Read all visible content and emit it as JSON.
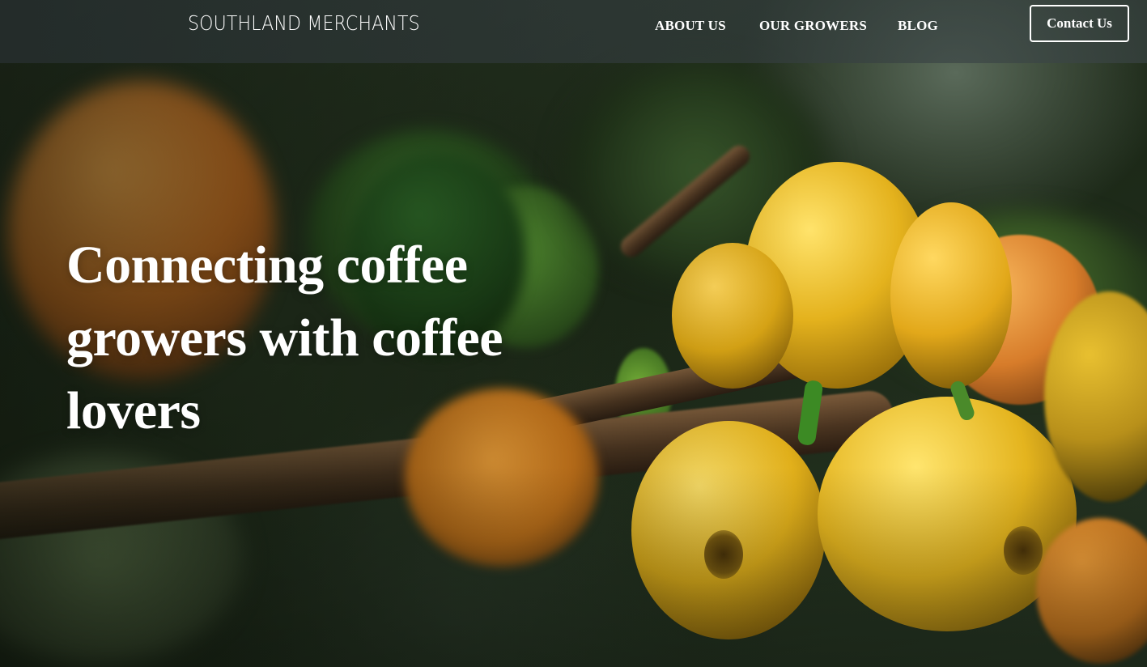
{
  "header": {
    "logo_text": "SOUTHLAND MERCHANTS",
    "nav": {
      "about": "ABOUT US",
      "growers": "OUR GROWERS",
      "blog": "BLOG"
    },
    "contact_label": "Contact Us"
  },
  "hero": {
    "headline": "Connecting coffee growers with coffee lovers",
    "background_icon": "coffee-cherries-photo"
  },
  "colors": {
    "text": "#ffffff",
    "header_overlay": "#2f3a3c",
    "cherry_yellow": "#e2b21a",
    "cherry_orange": "#d9822b",
    "foliage": "#2f5a22"
  }
}
